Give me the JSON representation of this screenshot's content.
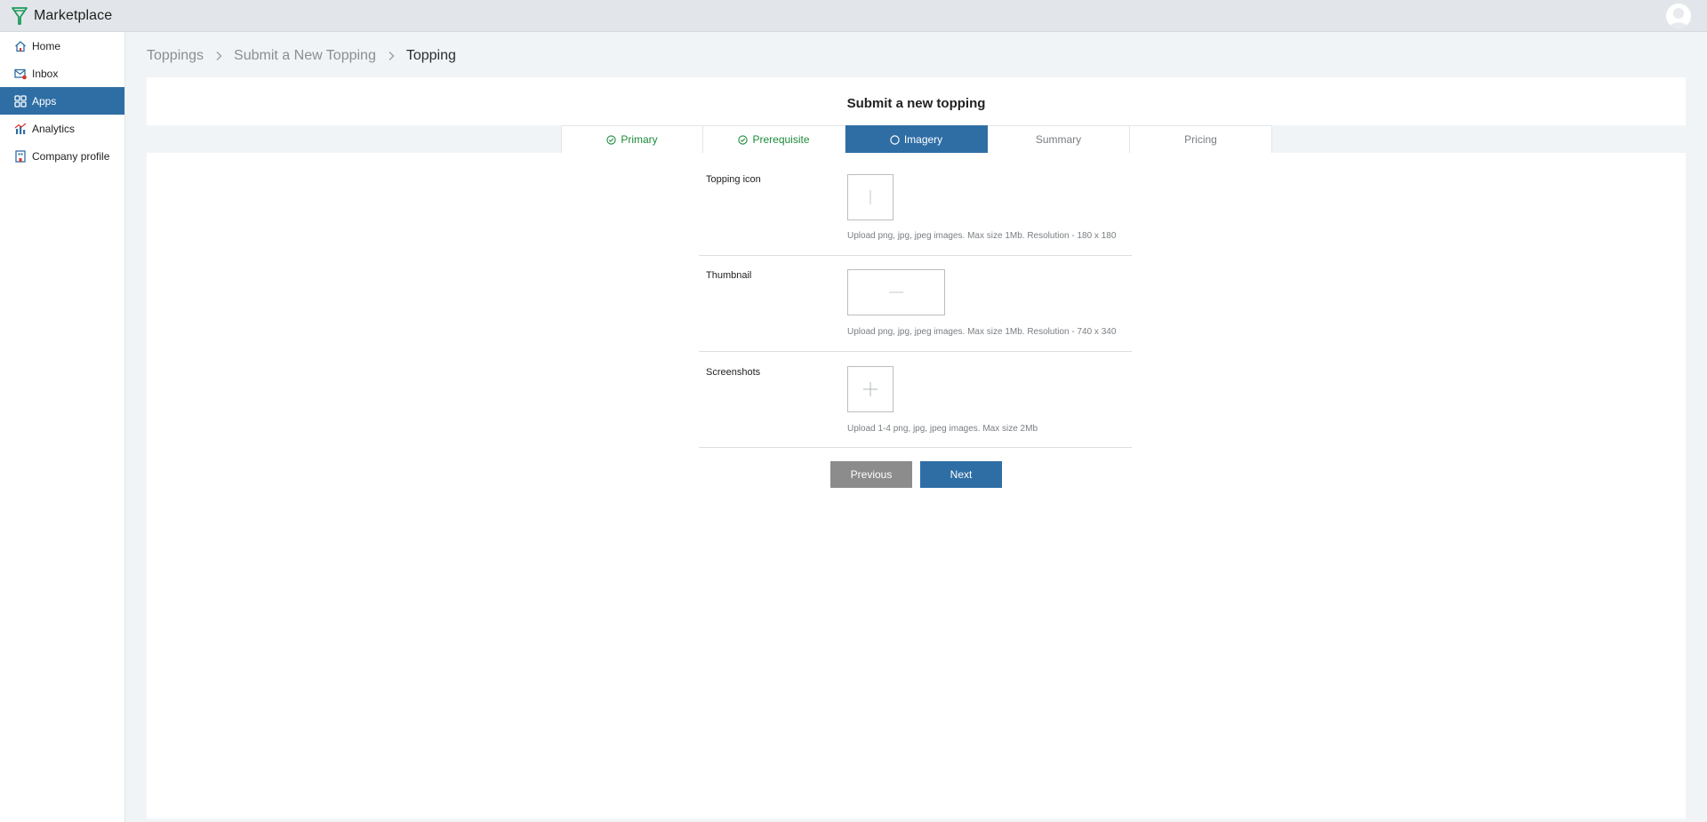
{
  "app": {
    "title": "Marketplace"
  },
  "sidebar": {
    "items": [
      {
        "label": "Home",
        "icon": "home-icon",
        "active": false
      },
      {
        "label": "Inbox",
        "icon": "inbox-icon",
        "active": false
      },
      {
        "label": "Apps",
        "icon": "apps-icon",
        "active": true
      },
      {
        "label": "Analytics",
        "icon": "analytics-icon",
        "active": false
      },
      {
        "label": "Company profile",
        "icon": "company-icon",
        "active": false
      }
    ]
  },
  "breadcrumb": [
    "Toppings",
    "Submit a New Topping",
    "Topping"
  ],
  "page": {
    "title": "Submit a new topping"
  },
  "tabs": [
    {
      "label": "Primary",
      "state": "done"
    },
    {
      "label": "Prerequisite",
      "state": "done"
    },
    {
      "label": "Imagery",
      "state": "active"
    },
    {
      "label": "Summary",
      "state": "pending"
    },
    {
      "label": "Pricing",
      "state": "pending"
    }
  ],
  "form": {
    "topping_icon": {
      "label": "Topping icon",
      "hint": "Upload png, jpg, jpeg images. Max size 1Mb. Resolution - 180 x 180"
    },
    "thumbnail": {
      "label": "Thumbnail",
      "hint": "Upload png, jpg, jpeg images. Max size 1Mb. Resolution - 740 x 340"
    },
    "screenshots": {
      "label": "Screenshots",
      "hint": "Upload 1-4 png, jpg, jpeg images. Max size 2Mb"
    }
  },
  "buttons": {
    "previous": "Previous",
    "next": "Next"
  },
  "colors": {
    "accent": "#2f6ea5",
    "done": "#1d8a3a",
    "secondary_button": "#8c8c8c"
  }
}
